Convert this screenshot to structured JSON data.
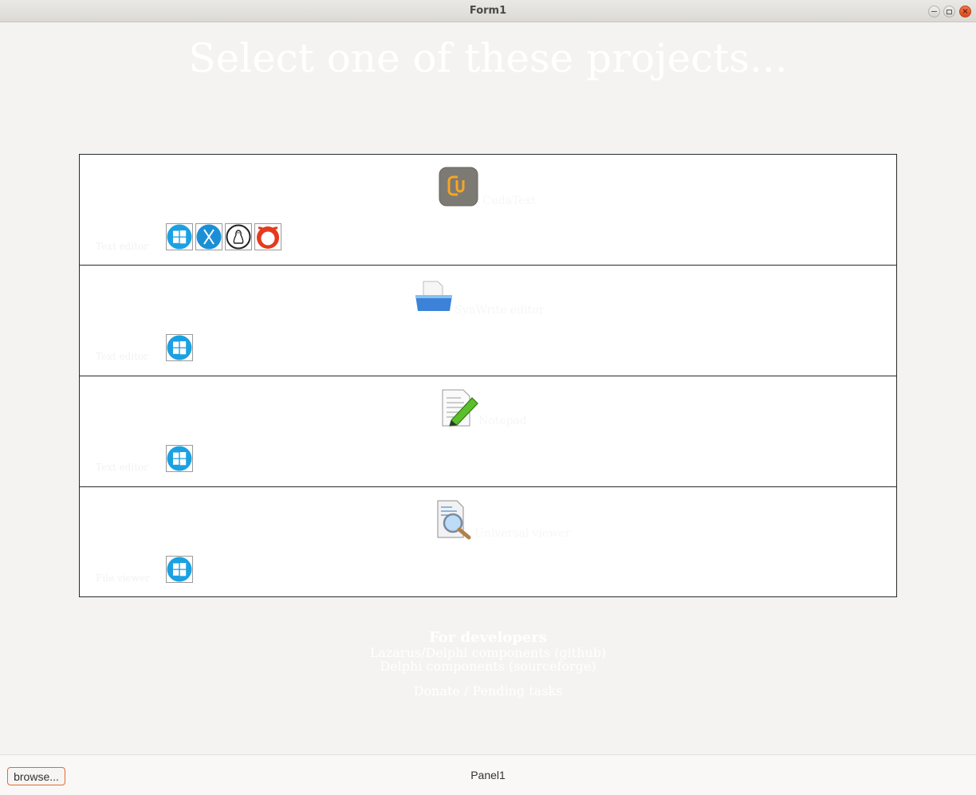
{
  "window": {
    "title": "Form1"
  },
  "heading": "Select one of these projects...",
  "projects": [
    {
      "name": "CudaText",
      "description": "Text editor",
      "logo_icon": "cudatext-logo-icon",
      "platforms": [
        "windows-icon",
        "macos-icon",
        "linux-icon",
        "freebsd-icon"
      ]
    },
    {
      "name": "SynWrite editor",
      "description": "Text editor",
      "logo_icon": "open-folder-icon",
      "platforms": [
        "windows-icon"
      ]
    },
    {
      "name": "Notepad",
      "description": "Text editor",
      "logo_icon": "document-pencil-icon",
      "platforms": [
        "windows-icon"
      ]
    },
    {
      "name": "Universal viewer",
      "description": "File viewer",
      "logo_icon": "document-magnifier-icon",
      "platforms": [
        "windows-icon"
      ]
    }
  ],
  "developers": {
    "title": "For developers",
    "link1": "Lazarus/Delphi components (github)",
    "link2": "Delphi components (sourceforge)",
    "donate": "Donate / Pending tasks"
  },
  "bottom_panel": {
    "browse_label": "browse...",
    "panel_label": "Panel1"
  },
  "colors": {
    "background": "#f4f3f1",
    "browse_border": "#e9692c",
    "windows_blue": "#1ba1e2",
    "freebsd_red": "#e53a1e"
  }
}
